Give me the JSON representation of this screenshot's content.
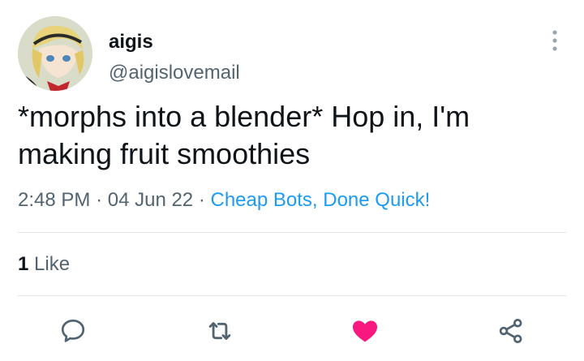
{
  "user": {
    "display_name": "aigis",
    "handle": "@aigislovemail"
  },
  "tweet": {
    "text": "*morphs into a blender* Hop in, I'm making fruit smoothies",
    "time": "2:48 PM",
    "date": "04 Jun 22",
    "separator": "·",
    "source": "Cheap Bots, Done Quick!"
  },
  "stats": {
    "like_count": "1",
    "like_label": " Like"
  },
  "actions": [
    {
      "name": "reply",
      "icon": "speech-bubble-icon"
    },
    {
      "name": "retweet",
      "icon": "retweet-icon"
    },
    {
      "name": "like",
      "icon": "heart-icon",
      "active": true
    },
    {
      "name": "share",
      "icon": "share-icon"
    }
  ],
  "colors": {
    "text": "#0f1419",
    "secondary": "#536471",
    "link": "#1d9bf0",
    "like_active": "#f91880",
    "divider": "#e3e7ea"
  }
}
